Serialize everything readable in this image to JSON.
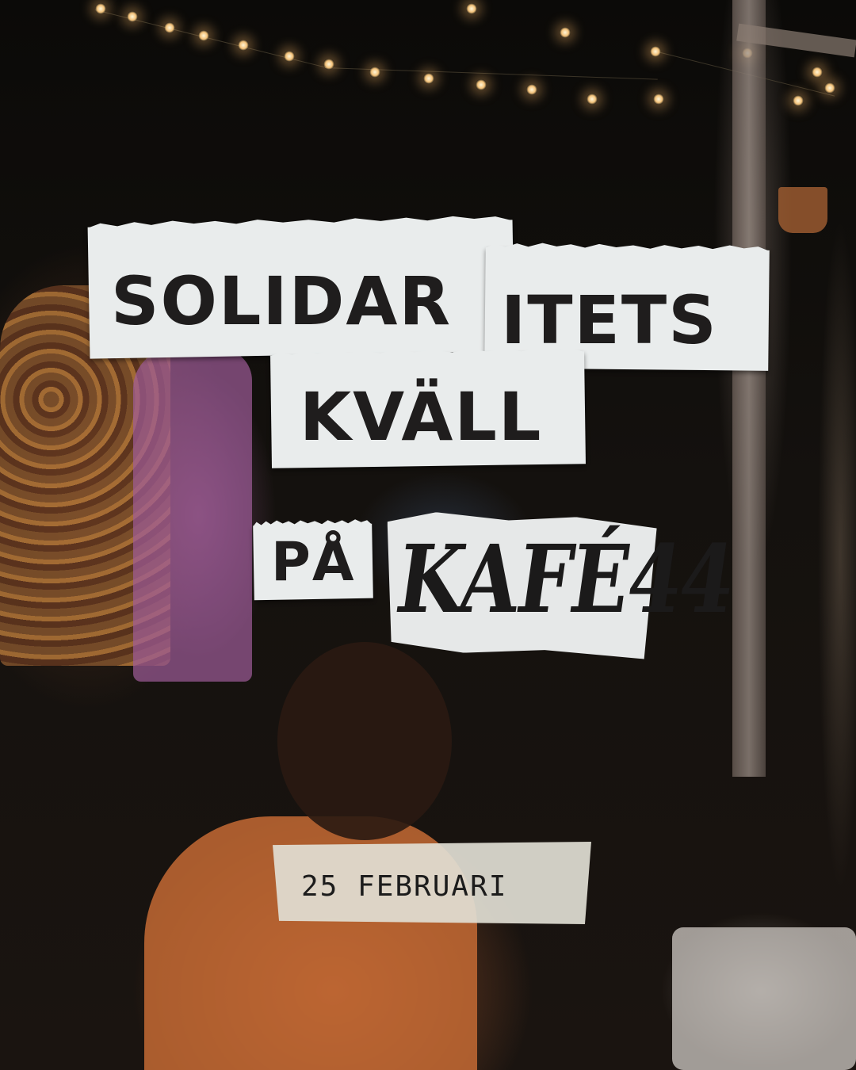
{
  "headline": {
    "line1a": "SOLIDAR",
    "line1b": "ITETS",
    "line2": "KVÄLL",
    "line3_prefix": "PÅ"
  },
  "logo": {
    "text": "KAFÉ44"
  },
  "event": {
    "date": "25 FEBRUARI"
  },
  "colors": {
    "paper": "#e9ecec",
    "ink": "#1f1d1d",
    "tape": "#e1ded4"
  }
}
